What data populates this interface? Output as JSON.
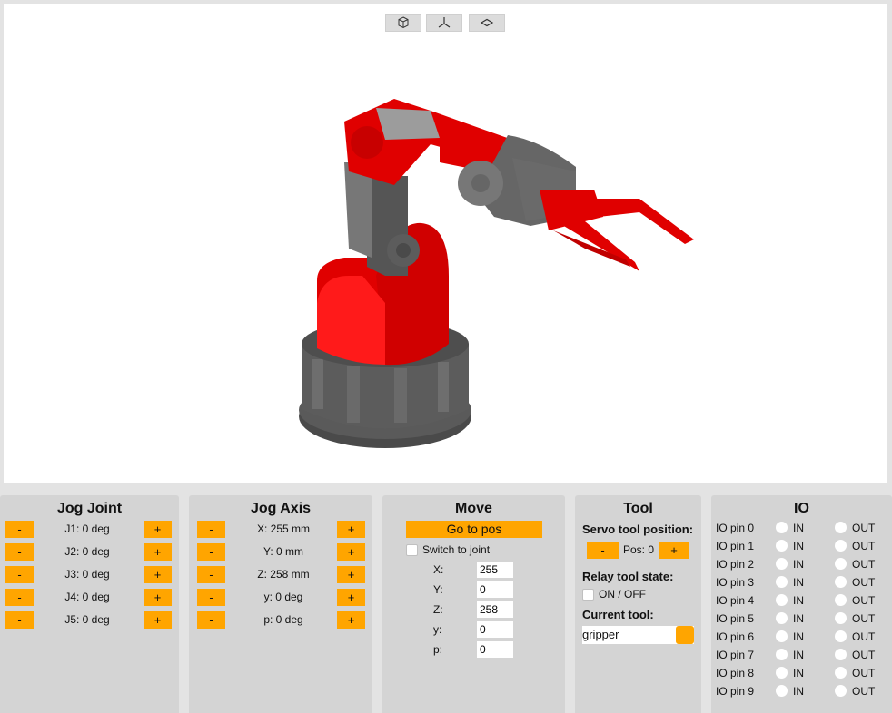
{
  "viewport": {
    "view_buttons": [
      {
        "name": "perspective-view-button",
        "icon": "cube-icon"
      },
      {
        "name": "axes-view-button",
        "icon": "axes-icon"
      },
      {
        "name": "top-view-button",
        "icon": "diamond-icon"
      }
    ],
    "model_colors": {
      "accent": "#e00000",
      "gray": "#555555",
      "base": "#3c3c3c"
    }
  },
  "jog_joint": {
    "title": "Jog Joint",
    "minus_label": "-",
    "plus_label": "+",
    "rows": [
      "J1: 0 deg",
      "J2: 0 deg",
      "J3: 0 deg",
      "J4: 0 deg",
      "J5: 0 deg"
    ]
  },
  "jog_axis": {
    "title": "Jog Axis",
    "minus_label": "-",
    "plus_label": "+",
    "rows": [
      "X: 255 mm",
      "Y: 0 mm",
      "Z: 258 mm",
      "y: 0 deg",
      "p: 0 deg"
    ]
  },
  "move": {
    "title": "Move",
    "go_button": "Go to pos",
    "switch_label": "Switch to joint",
    "fields": [
      {
        "label": "X:",
        "value": "255"
      },
      {
        "label": "Y:",
        "value": "0"
      },
      {
        "label": "Z:",
        "value": "258"
      },
      {
        "label": "y:",
        "value": "0"
      },
      {
        "label": "p:",
        "value": "0"
      }
    ]
  },
  "tool": {
    "title": "Tool",
    "servo_label": "Servo tool position:",
    "minus_label": "-",
    "plus_label": "+",
    "pos_text": "Pos: 0",
    "relay_label": "Relay tool state:",
    "relay_toggle": "ON / OFF",
    "current_label": "Current tool:",
    "current_value": "gripper"
  },
  "io": {
    "title": "IO",
    "in_label": "IN",
    "out_label": "OUT",
    "pins": [
      "IO pin 0",
      "IO pin 1",
      "IO pin 2",
      "IO pin 3",
      "IO pin 4",
      "IO pin 5",
      "IO pin 6",
      "IO pin 7",
      "IO pin 8",
      "IO pin 9"
    ]
  },
  "colors": {
    "button": "#ffa500",
    "panel": "#d4d4d4",
    "background": "#e3e3e3"
  }
}
